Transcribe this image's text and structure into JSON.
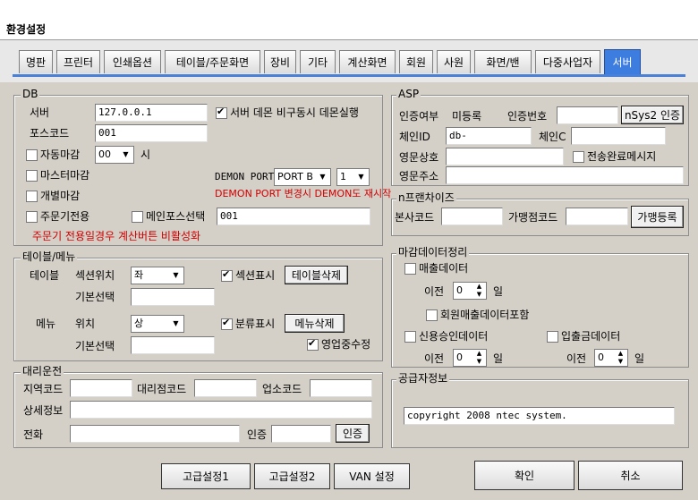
{
  "title": "환경설정",
  "tabs": [
    "명판",
    "프린터",
    "인쇄옵션",
    "테이블/주문화면",
    "장비",
    "기타",
    "계산화면",
    "회원",
    "사원",
    "화면/밴",
    "다중사업자",
    "서버"
  ],
  "db": {
    "legend": "DB",
    "server_label": "서버",
    "server_value": "127.0.0.1",
    "daemon_check": "서버 데몬 비구동시 데몬실행",
    "pos_label": "포스코드",
    "pos_value": "001",
    "auto_close": "자동마감",
    "auto_close_hour": "00",
    "hour_unit": "시",
    "master_close": "마스터마감",
    "demon_port_label": "DEMON PORT",
    "demon_port_value": "PORT B",
    "demon_port_num": "1",
    "individual_close": "개별마감",
    "demon_warning": "DEMON PORT 변경시 DEMON도 재시작",
    "order_only": "주문기전용",
    "main_pos_select": "메인포스선택",
    "main_pos_value": "001",
    "order_warning": "주문기 전용일경우 계산버튼 비활성화"
  },
  "table_menu": {
    "legend": "테이블/메뉴",
    "table_label": "테이블",
    "section_pos_label": "섹션위치",
    "section_pos_value": "좌",
    "section_show": "섹션표시",
    "table_delete": "테이블삭제",
    "default_select": "기본선택",
    "menu_label": "메뉴",
    "position_label": "위치",
    "position_value": "상",
    "category_show": "분류표시",
    "menu_delete": "메뉴삭제",
    "default_select2": "기본선택",
    "business_hold": "영업중수정"
  },
  "agency": {
    "legend": "대리운전",
    "region_code": "지역코드",
    "agency_code": "대리점코드",
    "business_code": "업소코드",
    "detail": "상세정보",
    "phone": "전화",
    "auth_label": "인증",
    "auth_button": "인증"
  },
  "asp": {
    "legend": "ASP",
    "auth_status_label": "인증여부",
    "auth_status_value": "미등록",
    "auth_no_label": "인증번호",
    "nsys_button": "nSys2 인증",
    "chain_id_label": "체인ID",
    "chain_id_value": "db-",
    "chain_c_label": "체인C",
    "english_name": "영문상호",
    "complete_msg": "전송완료메시지",
    "english_addr": "영문주소"
  },
  "franchise": {
    "legend": "n프랜차이즈",
    "hq_code": "본사코드",
    "store_code": "가맹점코드",
    "register_button": "가맹등록"
  },
  "closing": {
    "legend": "마감데이터정리",
    "sales_data": "매출데이터",
    "before": "이전",
    "sales_days": "0",
    "day_unit": "일",
    "include_member": "회원매출데이터포함",
    "credit_data": "신용승인데이터",
    "io_data": "입출금데이터",
    "credit_before": "이전",
    "credit_days": "0",
    "credit_unit": "일",
    "io_before": "이전",
    "io_days": "0",
    "io_unit": "일"
  },
  "supplier": {
    "legend": "공급자정보",
    "copyright": "copyright 2008 ntec system."
  },
  "footer": {
    "advanced1": "고급설정1",
    "advanced2": "고급설정2",
    "van": "VAN 설정",
    "ok": "확인",
    "cancel": "취소"
  }
}
